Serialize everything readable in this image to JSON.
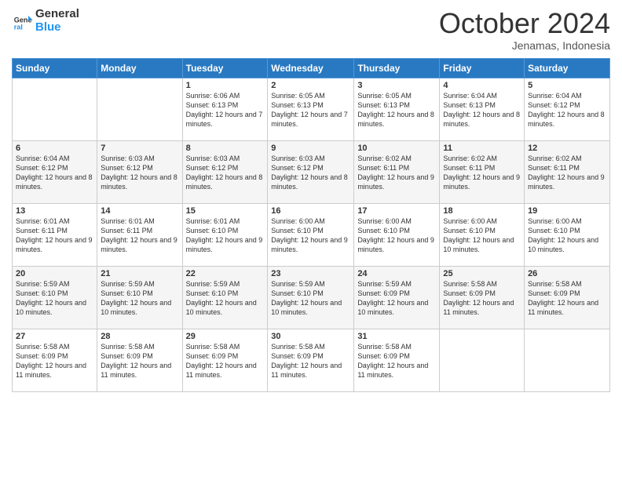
{
  "header": {
    "logo_line1": "General",
    "logo_line2": "Blue",
    "month": "October 2024",
    "location": "Jenamas, Indonesia"
  },
  "weekdays": [
    "Sunday",
    "Monday",
    "Tuesday",
    "Wednesday",
    "Thursday",
    "Friday",
    "Saturday"
  ],
  "weeks": [
    [
      {
        "day": "",
        "info": ""
      },
      {
        "day": "",
        "info": ""
      },
      {
        "day": "1",
        "info": "Sunrise: 6:06 AM\nSunset: 6:13 PM\nDaylight: 12 hours and 7 minutes."
      },
      {
        "day": "2",
        "info": "Sunrise: 6:05 AM\nSunset: 6:13 PM\nDaylight: 12 hours and 7 minutes."
      },
      {
        "day": "3",
        "info": "Sunrise: 6:05 AM\nSunset: 6:13 PM\nDaylight: 12 hours and 8 minutes."
      },
      {
        "day": "4",
        "info": "Sunrise: 6:04 AM\nSunset: 6:13 PM\nDaylight: 12 hours and 8 minutes."
      },
      {
        "day": "5",
        "info": "Sunrise: 6:04 AM\nSunset: 6:12 PM\nDaylight: 12 hours and 8 minutes."
      }
    ],
    [
      {
        "day": "6",
        "info": "Sunrise: 6:04 AM\nSunset: 6:12 PM\nDaylight: 12 hours and 8 minutes."
      },
      {
        "day": "7",
        "info": "Sunrise: 6:03 AM\nSunset: 6:12 PM\nDaylight: 12 hours and 8 minutes."
      },
      {
        "day": "8",
        "info": "Sunrise: 6:03 AM\nSunset: 6:12 PM\nDaylight: 12 hours and 8 minutes."
      },
      {
        "day": "9",
        "info": "Sunrise: 6:03 AM\nSunset: 6:12 PM\nDaylight: 12 hours and 8 minutes."
      },
      {
        "day": "10",
        "info": "Sunrise: 6:02 AM\nSunset: 6:11 PM\nDaylight: 12 hours and 9 minutes."
      },
      {
        "day": "11",
        "info": "Sunrise: 6:02 AM\nSunset: 6:11 PM\nDaylight: 12 hours and 9 minutes."
      },
      {
        "day": "12",
        "info": "Sunrise: 6:02 AM\nSunset: 6:11 PM\nDaylight: 12 hours and 9 minutes."
      }
    ],
    [
      {
        "day": "13",
        "info": "Sunrise: 6:01 AM\nSunset: 6:11 PM\nDaylight: 12 hours and 9 minutes."
      },
      {
        "day": "14",
        "info": "Sunrise: 6:01 AM\nSunset: 6:11 PM\nDaylight: 12 hours and 9 minutes."
      },
      {
        "day": "15",
        "info": "Sunrise: 6:01 AM\nSunset: 6:10 PM\nDaylight: 12 hours and 9 minutes."
      },
      {
        "day": "16",
        "info": "Sunrise: 6:00 AM\nSunset: 6:10 PM\nDaylight: 12 hours and 9 minutes."
      },
      {
        "day": "17",
        "info": "Sunrise: 6:00 AM\nSunset: 6:10 PM\nDaylight: 12 hours and 9 minutes."
      },
      {
        "day": "18",
        "info": "Sunrise: 6:00 AM\nSunset: 6:10 PM\nDaylight: 12 hours and 10 minutes."
      },
      {
        "day": "19",
        "info": "Sunrise: 6:00 AM\nSunset: 6:10 PM\nDaylight: 12 hours and 10 minutes."
      }
    ],
    [
      {
        "day": "20",
        "info": "Sunrise: 5:59 AM\nSunset: 6:10 PM\nDaylight: 12 hours and 10 minutes."
      },
      {
        "day": "21",
        "info": "Sunrise: 5:59 AM\nSunset: 6:10 PM\nDaylight: 12 hours and 10 minutes."
      },
      {
        "day": "22",
        "info": "Sunrise: 5:59 AM\nSunset: 6:10 PM\nDaylight: 12 hours and 10 minutes."
      },
      {
        "day": "23",
        "info": "Sunrise: 5:59 AM\nSunset: 6:10 PM\nDaylight: 12 hours and 10 minutes."
      },
      {
        "day": "24",
        "info": "Sunrise: 5:59 AM\nSunset: 6:09 PM\nDaylight: 12 hours and 10 minutes."
      },
      {
        "day": "25",
        "info": "Sunrise: 5:58 AM\nSunset: 6:09 PM\nDaylight: 12 hours and 11 minutes."
      },
      {
        "day": "26",
        "info": "Sunrise: 5:58 AM\nSunset: 6:09 PM\nDaylight: 12 hours and 11 minutes."
      }
    ],
    [
      {
        "day": "27",
        "info": "Sunrise: 5:58 AM\nSunset: 6:09 PM\nDaylight: 12 hours and 11 minutes."
      },
      {
        "day": "28",
        "info": "Sunrise: 5:58 AM\nSunset: 6:09 PM\nDaylight: 12 hours and 11 minutes."
      },
      {
        "day": "29",
        "info": "Sunrise: 5:58 AM\nSunset: 6:09 PM\nDaylight: 12 hours and 11 minutes."
      },
      {
        "day": "30",
        "info": "Sunrise: 5:58 AM\nSunset: 6:09 PM\nDaylight: 12 hours and 11 minutes."
      },
      {
        "day": "31",
        "info": "Sunrise: 5:58 AM\nSunset: 6:09 PM\nDaylight: 12 hours and 11 minutes."
      },
      {
        "day": "",
        "info": ""
      },
      {
        "day": "",
        "info": ""
      }
    ]
  ]
}
